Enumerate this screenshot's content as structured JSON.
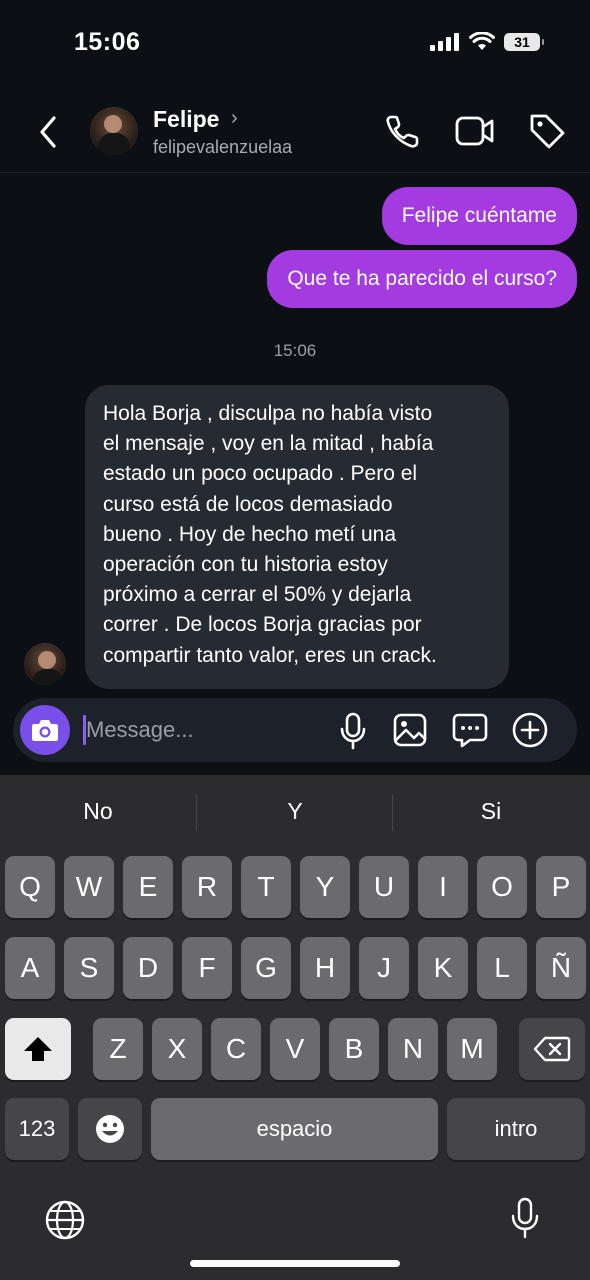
{
  "status_bar": {
    "time": "15:06",
    "battery": "31"
  },
  "header": {
    "name": "Felipe",
    "username": "felipevalenzuelaa"
  },
  "messages": {
    "outgoing": [
      "Felipe cuéntame",
      "Que te ha parecido el curso?"
    ],
    "timestamp": "15:06",
    "incoming_lines": [
      "Hola Borja , disculpa no había visto",
      "el mensaje , voy en la mitad , había",
      "estado un poco ocupado . Pero el",
      "curso está de locos demasiado",
      "bueno . Hoy de hecho metí una",
      "operación con tu historia estoy",
      "próximo a cerrar el 50% y dejarla",
      "correr . De locos Borja gracias por",
      "compartir tanto valor, eres un crack."
    ]
  },
  "composer": {
    "placeholder": "Message..."
  },
  "keyboard": {
    "suggestions": [
      "No",
      "Y",
      "Si"
    ],
    "row1": [
      "Q",
      "W",
      "E",
      "R",
      "T",
      "Y",
      "U",
      "I",
      "O",
      "P"
    ],
    "row2": [
      "A",
      "S",
      "D",
      "F",
      "G",
      "H",
      "J",
      "K",
      "L",
      "Ñ"
    ],
    "row3": [
      "Z",
      "X",
      "C",
      "V",
      "B",
      "N",
      "M"
    ],
    "numbers_label": "123",
    "space_label": "espacio",
    "return_label": "intro"
  },
  "colors": {
    "background": "#0c0f14",
    "outgoing_bubble": "#a33be0",
    "incoming_bubble": "#262a31",
    "camera_button": "#7a4ee8",
    "keyboard_bg": "#2c2c2e"
  }
}
